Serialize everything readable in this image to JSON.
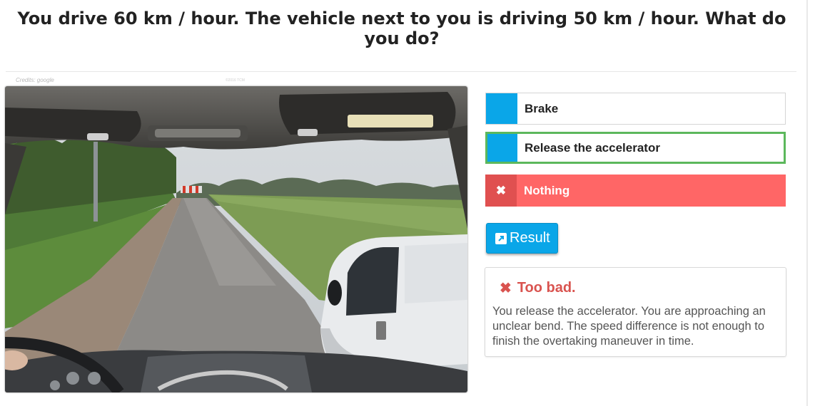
{
  "question": "You drive 60 km / hour. The vehicle next to you is driving 50 km / hour. What do you do?",
  "image": {
    "credits": "Credits: google",
    "watermark": "©2016 TCM"
  },
  "answers": [
    {
      "label": "Brake",
      "state": "default"
    },
    {
      "label": "Release the accelerator",
      "state": "selected"
    },
    {
      "label": "Nothing",
      "state": "wrong",
      "icon": "✖"
    }
  ],
  "result_button": {
    "label": "Result",
    "icon": "external-link-icon"
  },
  "feedback": {
    "icon": "✖",
    "title": "Too bad.",
    "text": "You release the accelerator. You are approaching an unclear bend. The speed difference is not enough to finish the overtaking maneuver in time."
  },
  "colors": {
    "accent": "#0aa6e8",
    "wrong": "#ff6666",
    "wrong_dark": "#e05050",
    "selected_border": "#5cb85c",
    "feedback_title": "#d9534f"
  }
}
